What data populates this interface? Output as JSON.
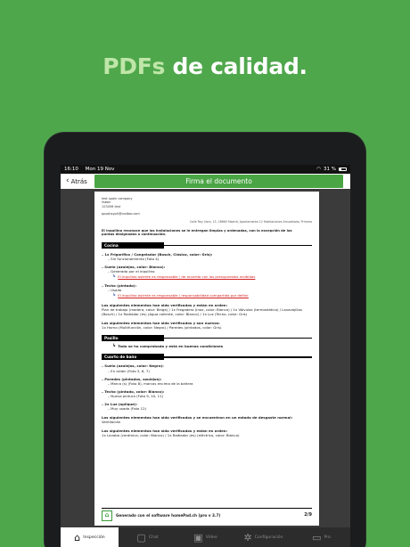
{
  "promo": {
    "accent": "PDFs",
    "rest": " de calidad."
  },
  "status": {
    "time": "16:10",
    "date": "Mon 19 Nov",
    "battery": "31 %"
  },
  "nav": {
    "back_label": "Atrás",
    "title": "Firma el documento"
  },
  "doc": {
    "company_lines": [
      "test spain company",
      "lisbon",
      "123456 test",
      "",
      "pposhsyph@codbor.com"
    ],
    "address": "Calle Rey Libro, 15, 28660 Madrid, Apartamento 12 Habitaciones Amueblado, Primero",
    "intro": "El inquilino reconoce que las instalaciones se le entregan limpias y ordenadas, con la excepción de los puntos designados a continuación.",
    "sections": {
      "cocina": "Cocina",
      "pasillo": "Pasillo",
      "bano": "Cuarto de baño"
    },
    "cocina": {
      "item1": "– 1x Frigorífico / Congelador (Bosch, Clásico, color: Gris):",
      "item1_sub": "– Sin funcionamiento (Foto 4)",
      "item2": "– Suelo (azulejos, color: Blanco):",
      "item2_sub": "– Generado por el inquilino",
      "item2_link": "El inquilino asiente es responsable / de acuerdo con los presupuestos recibidos",
      "item3": "– Techo (pintado):",
      "item3_sub": "– Usado",
      "item3_link": "El inquilino asiente es responsable / responsabilidad compartida por definir",
      "verified_head": "Los siguientes elementos han sido verificados y están en orden:",
      "verified_text": "Plan de trabajo (madera, color: Beige) / 1x Fregadero (Inox, color: Blanco) / 1x Válvulas (termostático) / Lavavajillas (Bosch) / 1x Radiador (es) (Agua caliente, color: Blanco) / 1x Luz (Techo, color: Gris)",
      "new_head": "Los siguientes elementos han sido verificados y son nuevos:",
      "new_text": "1x Horno (Multifunción, color: Negro) / Paredes (pintados, color: Gris)"
    },
    "pasillo_text": "Todo se ha comprobado y está en buenas condiciones",
    "bano": {
      "item1": "– Suelo (azulejos, color: Negro):",
      "item1_sub": "– En orden (Foto 5, 6, 7)",
      "item2": "– Paredes (pintados, azulejos):",
      "item2_sub": "– Marca (s) (Foto 8), marcas encima de la bañera",
      "item3": "– Techo (pintado, color: Blanco):",
      "item3_sub": "– Nueva pintura (Foto 9, 10, 11)",
      "item4": "– 2x Luz (aplique):",
      "item4_sub": "– Muy usado (Foto 12)",
      "wear_head": "Los siguientes elementos han sido verificados y se encuentran en un estado de desgaste normal:",
      "wear_text": "Ventilación",
      "ok_head": "Los siguientes elementos han sido verificados y están en orden:",
      "ok_text": "1x Lavabo (cerámica, color: Blanco) / 1x Radiador (es) (eléctrico, color: Blanco)"
    },
    "footer_text": "Generado con el software homePad.ch  (pro v 3.7)",
    "page": "2/9"
  },
  "tabs": [
    {
      "label": "Inspección",
      "icon": "home-icon"
    },
    {
      "label": "Chat",
      "icon": "chat-icon"
    },
    {
      "label": "Vídeo",
      "icon": "video-icon"
    },
    {
      "label": "Configuración",
      "icon": "gear-icon"
    },
    {
      "label": "Pro",
      "icon": "pro-icon"
    }
  ],
  "colors": {
    "brand_green": "#4fa74c",
    "nav_green": "#4aa544",
    "link_red": "#d32020"
  }
}
